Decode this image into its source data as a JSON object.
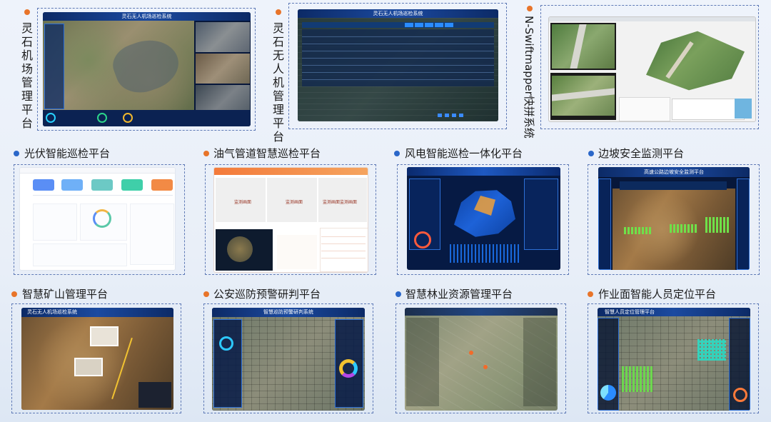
{
  "platforms": [
    {
      "id": "lingshi-airport",
      "title": "灵石机场管理平台",
      "bullet_color": "#e8742a",
      "screen_title": "灵石无人机场巡检系统"
    },
    {
      "id": "lingshi-uav",
      "title": "灵石无人机管理平台",
      "bullet_color": "#e8742a",
      "screen_title": "灵石无人机场巡检系统"
    },
    {
      "id": "n-swiftmapper",
      "title": "N-Swiftmapper快拼系统",
      "bullet_color": "#e8742a"
    },
    {
      "id": "pv-inspection",
      "title": "光伏智能巡检平台",
      "bullet_color": "#2b67c9"
    },
    {
      "id": "oil-gas",
      "title": "油气管道智慧巡检平台",
      "bullet_color": "#e8742a",
      "panel_labels": [
        "监测画面",
        "监测画面",
        "监测画面监测画面"
      ]
    },
    {
      "id": "wind-power",
      "title": "风电智能巡检一体化平台",
      "bullet_color": "#2b67c9"
    },
    {
      "id": "slope",
      "title": "边坡安全监测平台",
      "bullet_color": "#2b67c9",
      "screen_title": "高速公路边坡安全监测平台"
    },
    {
      "id": "mine",
      "title": "智慧矿山管理平台",
      "bullet_color": "#e8742a",
      "screen_title": "灵石无人机场巡检系统"
    },
    {
      "id": "police",
      "title": "公安巡防预警研判平台",
      "bullet_color": "#e8742a",
      "screen_title": "智慧巡防预警研判系统"
    },
    {
      "id": "forestry",
      "title": "智慧林业资源管理平台",
      "bullet_color": "#2b67c9"
    },
    {
      "id": "personnel",
      "title": "作业面智能人员定位平台",
      "bullet_color": "#e8742a",
      "screen_title": "智慧人员定位管理平台"
    }
  ],
  "colors": {
    "frame_border": "#5f7ab6",
    "dark_screen": "#07173a",
    "orange_bullet": "#e8742a",
    "blue_bullet": "#2b67c9"
  }
}
